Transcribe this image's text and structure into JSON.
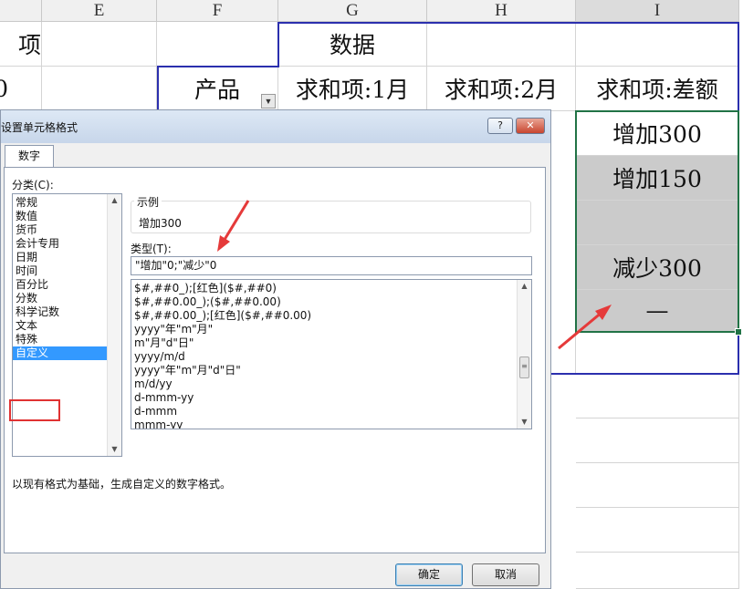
{
  "spreadsheet": {
    "column_headers": [
      "E",
      "F",
      "G",
      "H",
      "I"
    ],
    "row2_d": "项",
    "row2_g": "数据",
    "row3_d": "0",
    "row3_f": "产品",
    "row3_g": "求和项:1月",
    "row3_h": "求和项:2月",
    "row3_i": "求和项:差额",
    "i_values": [
      "增加300",
      "增加150",
      "",
      "减少300",
      "—"
    ],
    "dropdown_glyph": "▼"
  },
  "dialog": {
    "title": "设置单元格格式",
    "help_glyph": "?",
    "close_glyph": "✕",
    "tab_label": "数字",
    "category_label": "分类(C):",
    "categories": [
      "常规",
      "数值",
      "货币",
      "会计专用",
      "日期",
      "时间",
      "百分比",
      "分数",
      "科学记数",
      "文本",
      "特殊",
      "自定义"
    ],
    "selected_category": "自定义",
    "sample_label": "示例",
    "sample_value": "增加300",
    "type_label": "类型(T):",
    "type_value": "\"增加\"0;\"减少\"0",
    "formats": [
      "$#,##0_);[红色]($#,##0)",
      "$#,##0.00_);($#,##0.00)",
      "$#,##0.00_);[红色]($#,##0.00)",
      "yyyy\"年\"m\"月\"",
      "m\"月\"d\"日\"",
      "yyyy/m/d",
      "yyyy\"年\"m\"月\"d\"日\"",
      "m/d/yy",
      "d-mmm-yy",
      "d-mmm",
      "mmm-yy"
    ],
    "description": "以现有格式为基础，生成自定义的数字格式。",
    "ok_label": "确定",
    "cancel_label": "取消",
    "scroll_up": "▲",
    "scroll_down": "▼",
    "grip": "≡"
  },
  "colors": {
    "pivot_border": "#2b2fae",
    "selection": "#217346",
    "gray_fill": "#cbcbcb",
    "annotation_red": "#e53a3a",
    "selected_item": "#3399ff"
  }
}
